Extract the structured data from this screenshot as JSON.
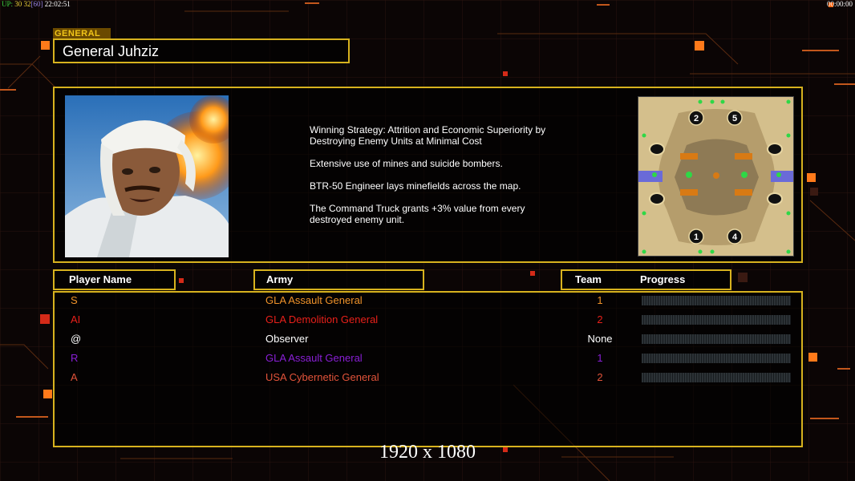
{
  "hud": {
    "stat_a": "UP:",
    "stat_b": "30",
    "stat_c": "32",
    "stat_d": "[60]",
    "time": "22:02:51",
    "clock": "00:00:00"
  },
  "general_tag": "GENERAL",
  "general_name": "General Juhziz",
  "description": [
    "Winning Strategy: Attrition and Economic Superiority by\n Destroying Enemy Units at Minimal Cost",
    "Extensive use of mines and suicide bombers.",
    "BTR-50 Engineer lays minefields across the map.",
    "The Command Truck grants +3% value from every\n destroyed enemy unit."
  ],
  "minimap": {
    "start_positions": [
      "2",
      "5",
      "1",
      "4"
    ]
  },
  "headers": {
    "player_name": "Player Name",
    "army": "Army",
    "team": "Team",
    "progress": "Progress"
  },
  "players": [
    {
      "name": "S",
      "army": "GLA Assault General",
      "team": "1",
      "color": "#f0932a",
      "progress": 0
    },
    {
      "name": "AI",
      "army": "GLA Demolition General",
      "team": "2",
      "color": "#e8201a",
      "progress": 0
    },
    {
      "name": "@",
      "army": "Observer",
      "team": "None",
      "color": "#ffffff",
      "progress": 0
    },
    {
      "name": "R",
      "army": "GLA Assault General",
      "team": "1",
      "color": "#8a1fd6",
      "progress": 0
    },
    {
      "name": "A",
      "army": "USA Cybernetic General",
      "team": "2",
      "color": "#e2533a",
      "progress": 0
    }
  ],
  "resolution_text": "1920 x 1080",
  "colors": {
    "frame_gold": "#d7b21e",
    "accent_orange": "#ff7a1a"
  }
}
